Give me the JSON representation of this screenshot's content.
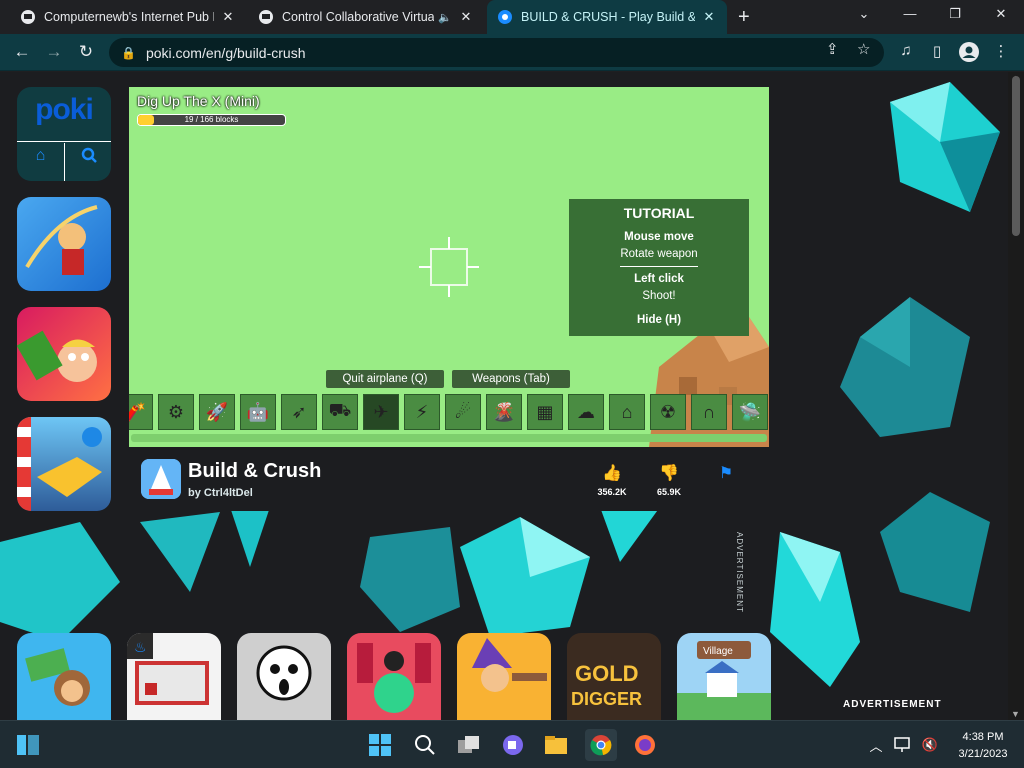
{
  "browser": {
    "tabs": [
      {
        "title": "Computernewb's Internet Pub Ho",
        "close": "✕"
      },
      {
        "title": "Control Collaborative Virtual",
        "close": "✕"
      },
      {
        "title": "BUILD & CRUSH - Play Build & C",
        "close": "✕"
      }
    ],
    "new_tab": "+",
    "url": "poki.com/en/g/build-crush"
  },
  "site": {
    "logo": "poki"
  },
  "game": {
    "level_title": "Dig Up The X (Mini)",
    "progress_text": "19 / 166 blocks",
    "progress_fraction": 0.11,
    "tutorial": {
      "heading": "TUTORIAL",
      "mouse_move": "Mouse move",
      "rotate": "Rotate weapon",
      "left_click": "Left click",
      "shoot": "Shoot!",
      "hide": "Hide (H)"
    },
    "quit_button": "Quit airplane (Q)",
    "weapons_button": "Weapons (Tab)",
    "weapon_slots": [
      "dynamite-icon",
      "tire-icon",
      "rocket-icon",
      "robot-icon",
      "missile-icon",
      "cannon-icon",
      "airplane-icon",
      "lightning-icon",
      "meteor-icon",
      "volcano-icon",
      "tower-icon",
      "cloud-icon",
      "house-icon",
      "nuke-icon",
      "magnet-icon",
      "ufo-icon"
    ],
    "selected_slot": 6
  },
  "info": {
    "title": "Build & Crush",
    "author": "by Ctrl4ltDel",
    "likes": "356.2K",
    "dislikes": "65.9K"
  },
  "ads": {
    "side_label": "ADVERTISEMENT",
    "bottom_label": "ADVERTISEMENT"
  },
  "clock": {
    "time": "4:38 PM",
    "date": "3/21/2023"
  }
}
